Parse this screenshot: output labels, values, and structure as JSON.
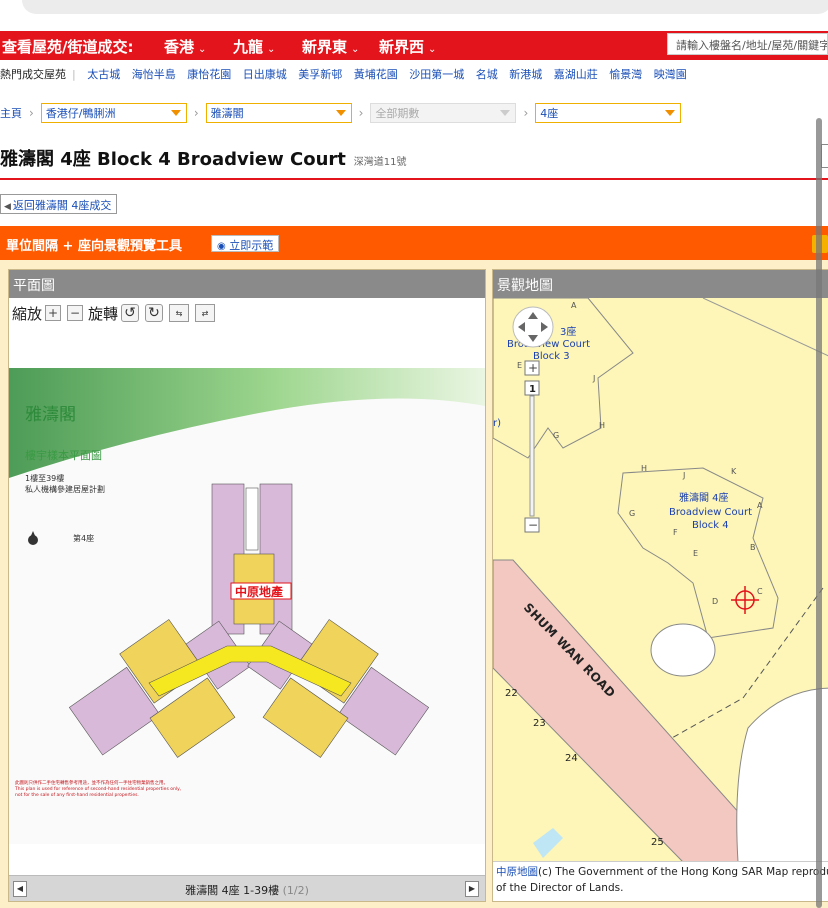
{
  "header": {
    "title": "查看屋苑/街道成交:",
    "regions": [
      {
        "label": "香港"
      },
      {
        "label": "九龍"
      },
      {
        "label": "新界東"
      },
      {
        "label": "新界西"
      }
    ],
    "search_placeholder": "請輸入樓盤名/地址/屋苑/關鍵字"
  },
  "hot_estates": {
    "label": "熱門成交屋苑",
    "items": [
      "太古城",
      "海怡半島",
      "康怡花園",
      "日出康城",
      "美孚新邨",
      "黃埔花園",
      "沙田第一城",
      "名城",
      "新港城",
      "嘉湖山莊",
      "愉景灣",
      "映灣園"
    ]
  },
  "breadcrumb": {
    "home": "主頁",
    "district": "香港仔/鴨脷洲",
    "estate": "雅濤閣",
    "phase": "全部期數",
    "block": "4座"
  },
  "page": {
    "title": "雅濤閣 4座 Block 4 Broadview Court",
    "address": "深灣道11號",
    "back_button": "返回雅濤閣 4座成交"
  },
  "tool": {
    "title": "單位間隔 + 座向景觀預覽工具",
    "demo_button": "立即示範"
  },
  "floor_plan": {
    "header": "平面圖",
    "zoom_label": "縮放",
    "rotate_label": "旋轉",
    "plan_title": "雅濤閣",
    "plan_subtitle": "樓宇樣本平面圖",
    "plan_floors": "1樓至39樓",
    "plan_scheme": "私人機構參建居屋計劃",
    "plan_block": "第4座",
    "watermark": "中原地產",
    "disclaimer_line1": "此圖則只供作二手住宅轉售參考用途，並不作為任何一手住宅物業銷售之用。",
    "disclaimer_line2": "This plan is used for reference of second-hand residential properties only,",
    "disclaimer_line3": "not for the sale of any first-hand residential properties.",
    "footer_label": "雅濤閣 4座 1-39樓",
    "footer_page": "(1/2)"
  },
  "view_map": {
    "header": "景觀地圖",
    "zoom_level": "1",
    "labels": {
      "block3_cn": "3座",
      "block3_en": "Broadview Court",
      "block3_block": "Block 3",
      "block4_cn": "雅濤閣 4座",
      "block4_en": "Broadview Court",
      "block4_block": "Block 4",
      "road": "SHUM WAN ROAD",
      "cut_r": "r)"
    },
    "unit_letters": [
      "A",
      "B",
      "C",
      "D",
      "E",
      "F",
      "G",
      "H",
      "J",
      "K"
    ],
    "lot_numbers": [
      "22",
      "23",
      "24",
      "25"
    ],
    "credit_link": "中原地圖",
    "credit_text": "(c) The Government of the Hong Kong SAR Map reproduced with permission",
    "credit_line2": "of the Director of Lands."
  },
  "colors": {
    "brand_red": "#e3141b",
    "tool_orange": "#ff5a00",
    "link_blue": "#1a4fb7",
    "map_yellow": "#fdf6b8"
  }
}
